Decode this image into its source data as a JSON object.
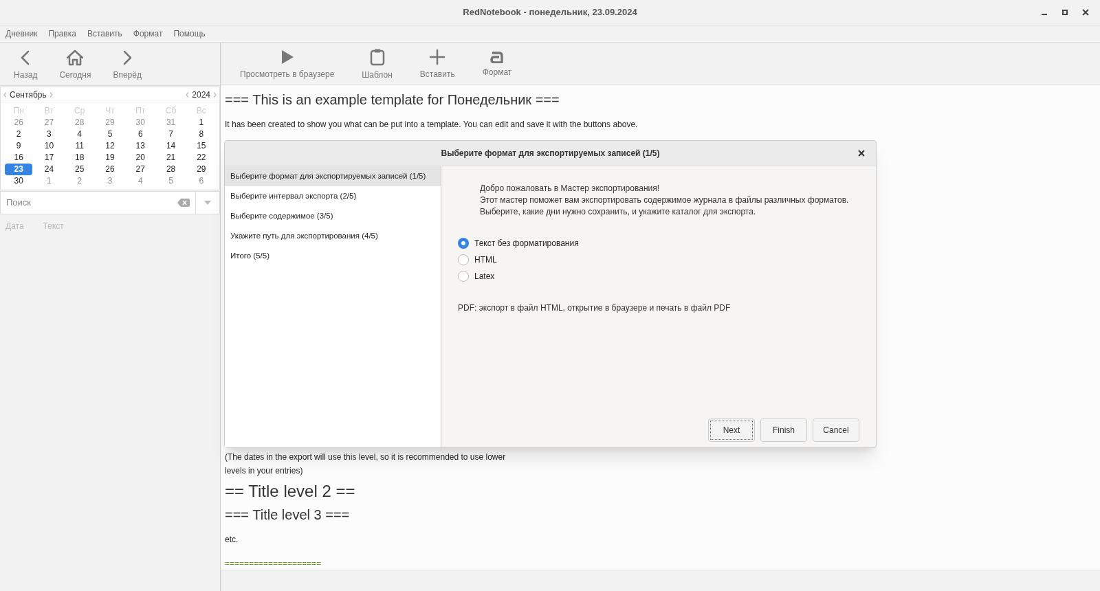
{
  "window": {
    "title": "RedNotebook - понедельник, 23.09.2024"
  },
  "menu": [
    "Дневник",
    "Правка",
    "Вставить",
    "Формат",
    "Помощь"
  ],
  "nav_toolbar": [
    {
      "kind": "back",
      "label": "Назад"
    },
    {
      "kind": "home",
      "label": "Сегодня"
    },
    {
      "kind": "forward",
      "label": "Вперёд"
    }
  ],
  "edit_toolbar": [
    {
      "kind": "play",
      "label": "Просмотреть в браузере"
    },
    {
      "kind": "template",
      "label": "Шаблон"
    },
    {
      "kind": "insert",
      "label": "Вставить"
    },
    {
      "kind": "format",
      "label": "Формат"
    }
  ],
  "calendar": {
    "month": "Сентябрь",
    "year": "2024",
    "weekdays": [
      "Пн",
      "Вт",
      "Ср",
      "Чт",
      "Пт",
      "Сб",
      "Вс"
    ],
    "weeks": [
      [
        {
          "day": "26",
          "other": true,
          "selected": false
        },
        {
          "day": "27",
          "other": true,
          "selected": false
        },
        {
          "day": "28",
          "other": true,
          "selected": false
        },
        {
          "day": "29",
          "other": true,
          "selected": false
        },
        {
          "day": "30",
          "other": true,
          "selected": false
        },
        {
          "day": "31",
          "other": true,
          "selected": false
        },
        {
          "day": "1",
          "other": false,
          "selected": false
        }
      ],
      [
        {
          "day": "2",
          "other": false,
          "selected": false
        },
        {
          "day": "3",
          "other": false,
          "selected": false
        },
        {
          "day": "4",
          "other": false,
          "selected": false
        },
        {
          "day": "5",
          "other": false,
          "selected": false
        },
        {
          "day": "6",
          "other": false,
          "selected": false
        },
        {
          "day": "7",
          "other": false,
          "selected": false
        },
        {
          "day": "8",
          "other": false,
          "selected": false
        }
      ],
      [
        {
          "day": "9",
          "other": false,
          "selected": false
        },
        {
          "day": "10",
          "other": false,
          "selected": false
        },
        {
          "day": "11",
          "other": false,
          "selected": false
        },
        {
          "day": "12",
          "other": false,
          "selected": false
        },
        {
          "day": "13",
          "other": false,
          "selected": false
        },
        {
          "day": "14",
          "other": false,
          "selected": false
        },
        {
          "day": "15",
          "other": false,
          "selected": false
        }
      ],
      [
        {
          "day": "16",
          "other": false,
          "selected": false
        },
        {
          "day": "17",
          "other": false,
          "selected": false
        },
        {
          "day": "18",
          "other": false,
          "selected": false
        },
        {
          "day": "19",
          "other": false,
          "selected": false
        },
        {
          "day": "20",
          "other": false,
          "selected": false
        },
        {
          "day": "21",
          "other": false,
          "selected": false
        },
        {
          "day": "22",
          "other": false,
          "selected": false
        }
      ],
      [
        {
          "day": "23",
          "other": false,
          "selected": true
        },
        {
          "day": "24",
          "other": false,
          "selected": false
        },
        {
          "day": "25",
          "other": false,
          "selected": false
        },
        {
          "day": "26",
          "other": false,
          "selected": false
        },
        {
          "day": "27",
          "other": false,
          "selected": false
        },
        {
          "day": "28",
          "other": false,
          "selected": false
        },
        {
          "day": "29",
          "other": false,
          "selected": false
        }
      ],
      [
        {
          "day": "30",
          "other": false,
          "selected": false
        },
        {
          "day": "1",
          "other": true,
          "selected": false
        },
        {
          "day": "2",
          "other": true,
          "selected": false
        },
        {
          "day": "3",
          "other": true,
          "selected": false
        },
        {
          "day": "4",
          "other": true,
          "selected": false
        },
        {
          "day": "5",
          "other": true,
          "selected": false
        },
        {
          "day": "6",
          "other": true,
          "selected": false
        }
      ]
    ]
  },
  "search": {
    "placeholder": "Поиск"
  },
  "results_columns": [
    "Дата",
    "Текст"
  ],
  "editor": {
    "top": [
      {
        "kind": "h3",
        "text": "=== This is an example template for Понедельник ==="
      },
      {
        "kind": "p",
        "text": "It has been created to show you what can be put into a template. You can edit and save it with the buttons above."
      }
    ],
    "bottom": [
      {
        "kind": "note",
        "text": "(The dates in the export will use this level, so it is recommended to use lower levels in your entries)"
      },
      {
        "kind": "h2",
        "text": "== Title level 2 =="
      },
      {
        "kind": "h3",
        "text": "=== Title level 3 ==="
      },
      {
        "kind": "p",
        "text": "etc."
      },
      {
        "kind": "rule",
        "text": "===================="
      }
    ]
  },
  "dialog": {
    "title": "Выберите формат для экспортируемых записей (1/5)",
    "steps": [
      {
        "label": "Выберите формат для экспортируемых записей (1/5)",
        "selected": true
      },
      {
        "label": "Выберите интервал экспорта (2/5)",
        "selected": false
      },
      {
        "label": "Выберите содержимое (3/5)",
        "selected": false
      },
      {
        "label": "Укажите путь для экспортирования (4/5)",
        "selected": false
      },
      {
        "label": "Итого (5/5)",
        "selected": false
      }
    ],
    "intro": [
      "Добро пожаловать в Мастер экспортирования!",
      "Этот мастер поможет вам экспортировать содержимое журнала в файлы различных форматов.",
      "Выберите, какие дни нужно сохранить, и укажите каталог для экспорта."
    ],
    "formats": [
      {
        "label": "Текст без форматирования",
        "selected": true
      },
      {
        "label": "HTML",
        "selected": false
      },
      {
        "label": "Latex",
        "selected": false
      }
    ],
    "note": "PDF: экспорт в файл HTML, открытие в браузере и печать в файл PDF",
    "buttons": [
      {
        "label": "Next",
        "focused": true
      },
      {
        "label": "Finish",
        "focused": false
      },
      {
        "label": "Cancel",
        "focused": false
      }
    ]
  }
}
